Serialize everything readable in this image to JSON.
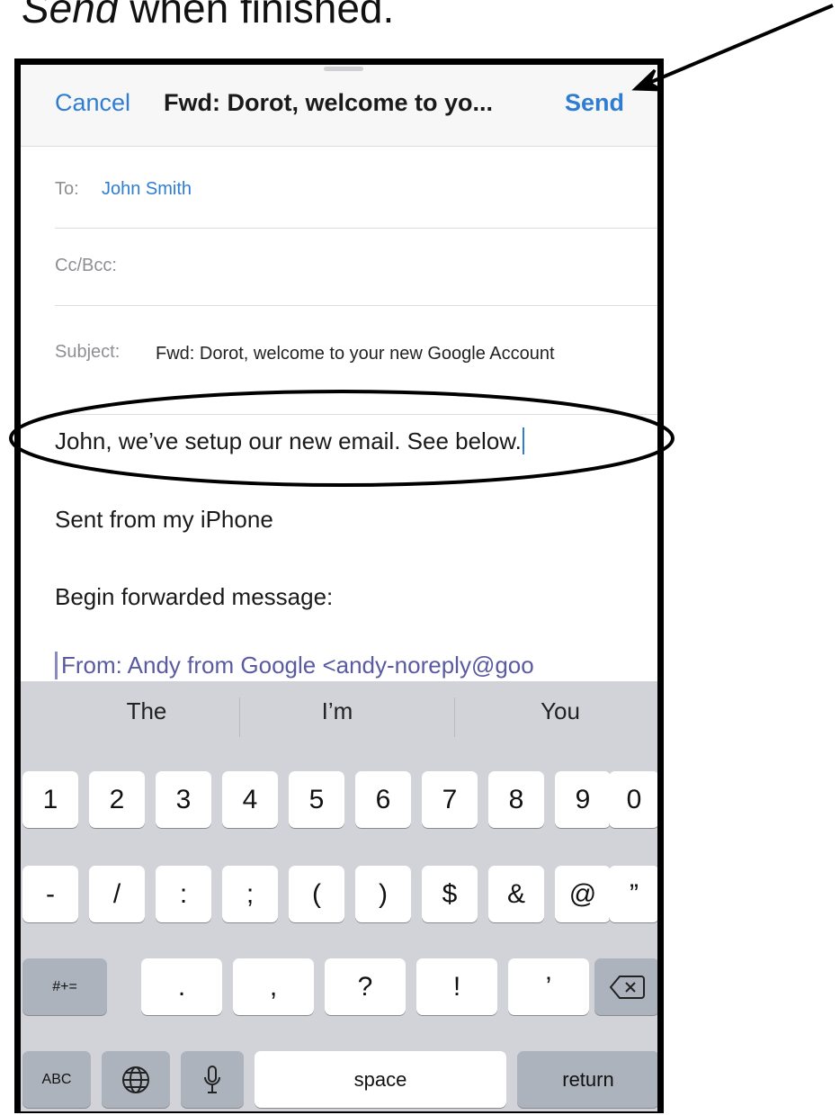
{
  "instruction": {
    "italic": "Send",
    "rest": " when finished."
  },
  "header": {
    "cancel": "Cancel",
    "title": "Fwd: Dorot, welcome to yo...",
    "send": "Send"
  },
  "fields": {
    "to_label": "To:",
    "to_value": "John Smith",
    "cc_label": "Cc/Bcc:",
    "subject_label": "Subject:",
    "subject_value": "Fwd: Dorot, welcome to your new Google Account"
  },
  "body": {
    "typed": "John, we’ve setup our new email. See below.",
    "signature": "Sent from my iPhone",
    "forward_header": "Begin forwarded message:",
    "from_line": "From: Andy from Google <andy-noreply@goo"
  },
  "suggestions": [
    "The",
    "I’m",
    "You"
  ],
  "keyboard": {
    "row1": [
      "1",
      "2",
      "3",
      "4",
      "5",
      "6",
      "7",
      "8",
      "9",
      "0"
    ],
    "row2": [
      "-",
      "/",
      ":",
      ";",
      "(",
      ")",
      "$",
      "&",
      "@",
      "”"
    ],
    "row3": [
      "#+=",
      ".",
      ",",
      "?",
      "!",
      "’"
    ],
    "abc": "ABC",
    "space": "space",
    "return": "return"
  }
}
